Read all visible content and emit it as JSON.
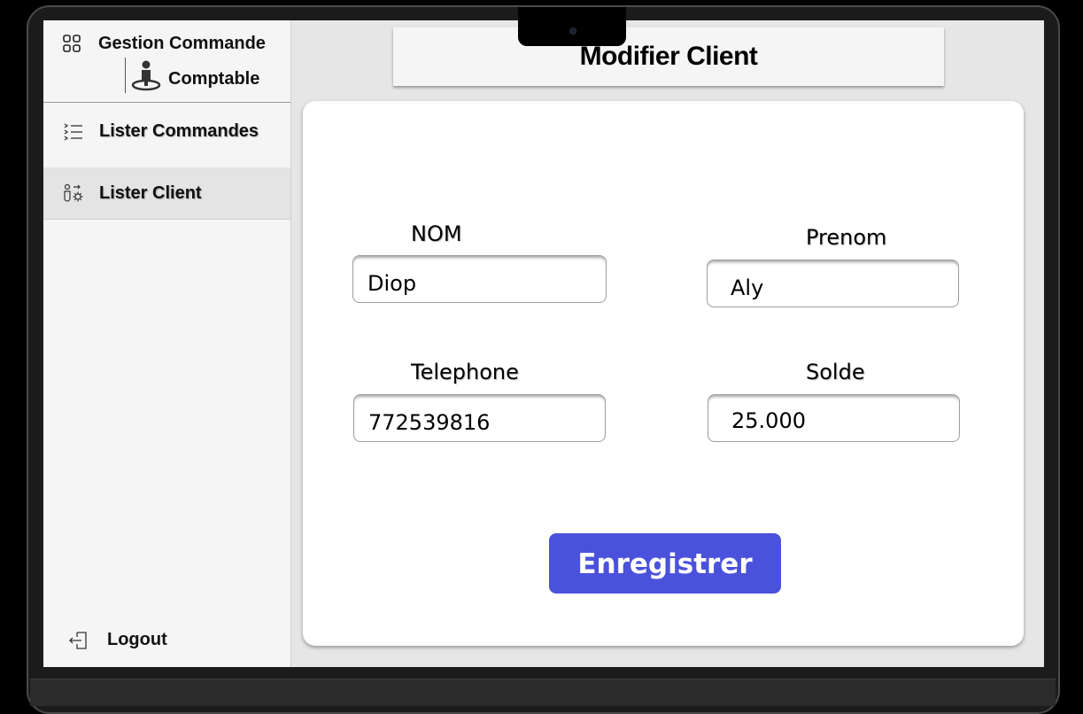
{
  "sidebar": {
    "brand": {
      "title": "Gestion Commande",
      "role": "Comptable",
      "icon": "grid-icon",
      "user_icon": "user-icon"
    },
    "items": [
      {
        "label": "Lister Commandes",
        "icon": "list-icon",
        "active": false
      },
      {
        "label": "Lister Client",
        "icon": "user-settings-icon",
        "active": true
      }
    ],
    "logout": {
      "label": "Logout",
      "icon": "logout-icon"
    }
  },
  "header": {
    "title": "Modifier Client"
  },
  "form": {
    "nom": {
      "label": "NOM",
      "value": "Diop"
    },
    "prenom": {
      "label": "Prenom",
      "value": "Aly"
    },
    "telephone": {
      "label": "Telephone",
      "value": "772539816"
    },
    "solde": {
      "label": "Solde",
      "value": "25.000"
    },
    "submit_label": "Enregistrer"
  },
  "colors": {
    "accent": "#4a52dc",
    "sidebar_bg": "#f5f5f5",
    "screen_bg": "#e6e6e6"
  }
}
